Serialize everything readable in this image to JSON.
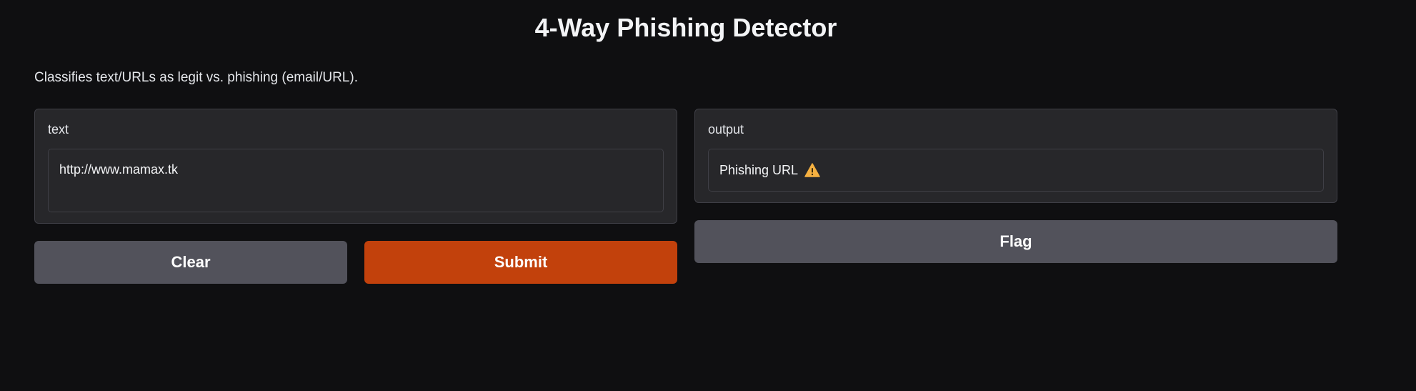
{
  "header": {
    "title": "4-Way Phishing Detector",
    "description": "Classifies text/URLs as legit vs. phishing (email/URL)."
  },
  "input": {
    "label": "text",
    "value": "http://www.mamax.tk"
  },
  "output": {
    "label": "output",
    "value": "Phishing URL",
    "icon": "warning-icon"
  },
  "actions": {
    "clear_label": "Clear",
    "submit_label": "Submit",
    "flag_label": "Flag"
  },
  "colors": {
    "background": "#0f0f11",
    "panel": "#27272a",
    "primary": "#c2410c",
    "secondary": "#52525b",
    "warning": "#f59e0b"
  }
}
